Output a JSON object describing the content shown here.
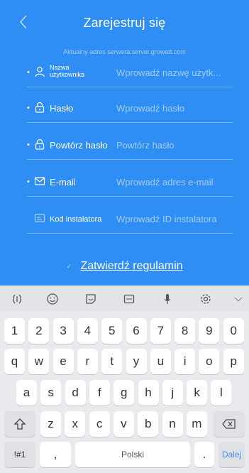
{
  "header": {
    "title": "Zarejestruj się",
    "server_info": "Aktualny adres serwera:server.growatt.com"
  },
  "form": {
    "required_mark": "•",
    "username": {
      "label": "Nazwa użytkownika",
      "placeholder": "Wprowadź nazwę użytk..."
    },
    "password": {
      "label": "Hasło",
      "placeholder": "Wprowadź hasło"
    },
    "password_repeat": {
      "label": "Powtórz hasło",
      "placeholder": "Powtórz hasło"
    },
    "email": {
      "label": "E-mail",
      "placeholder": "Wprowadź adres e-mail"
    },
    "installer": {
      "label": "Kod instalatora",
      "placeholder": "Wprowadź ID instalatora"
    }
  },
  "terms": {
    "checkbox_mark": "✓",
    "label": "Zatwierdź regulamin"
  },
  "keyboard": {
    "toolbar_icons": [
      "cursor-icon",
      "emoji-icon",
      "sticker-icon",
      "gif-icon",
      "microphone-icon",
      "settings-icon",
      "collapse-icon"
    ],
    "numbers": [
      "1",
      "2",
      "3",
      "4",
      "5",
      "6",
      "7",
      "8",
      "9",
      "0"
    ],
    "row1": [
      "q",
      "w",
      "e",
      "r",
      "t",
      "y",
      "u",
      "i",
      "o",
      "p"
    ],
    "row2": [
      "a",
      "s",
      "d",
      "f",
      "g",
      "h",
      "j",
      "k",
      "l"
    ],
    "row3": [
      "z",
      "x",
      "c",
      "v",
      "b",
      "n",
      "m"
    ],
    "symbols_key": "!#1",
    "comma_key": ",",
    "space_label": "Polski",
    "period_key": ".",
    "enter_label": "Dalej"
  }
}
